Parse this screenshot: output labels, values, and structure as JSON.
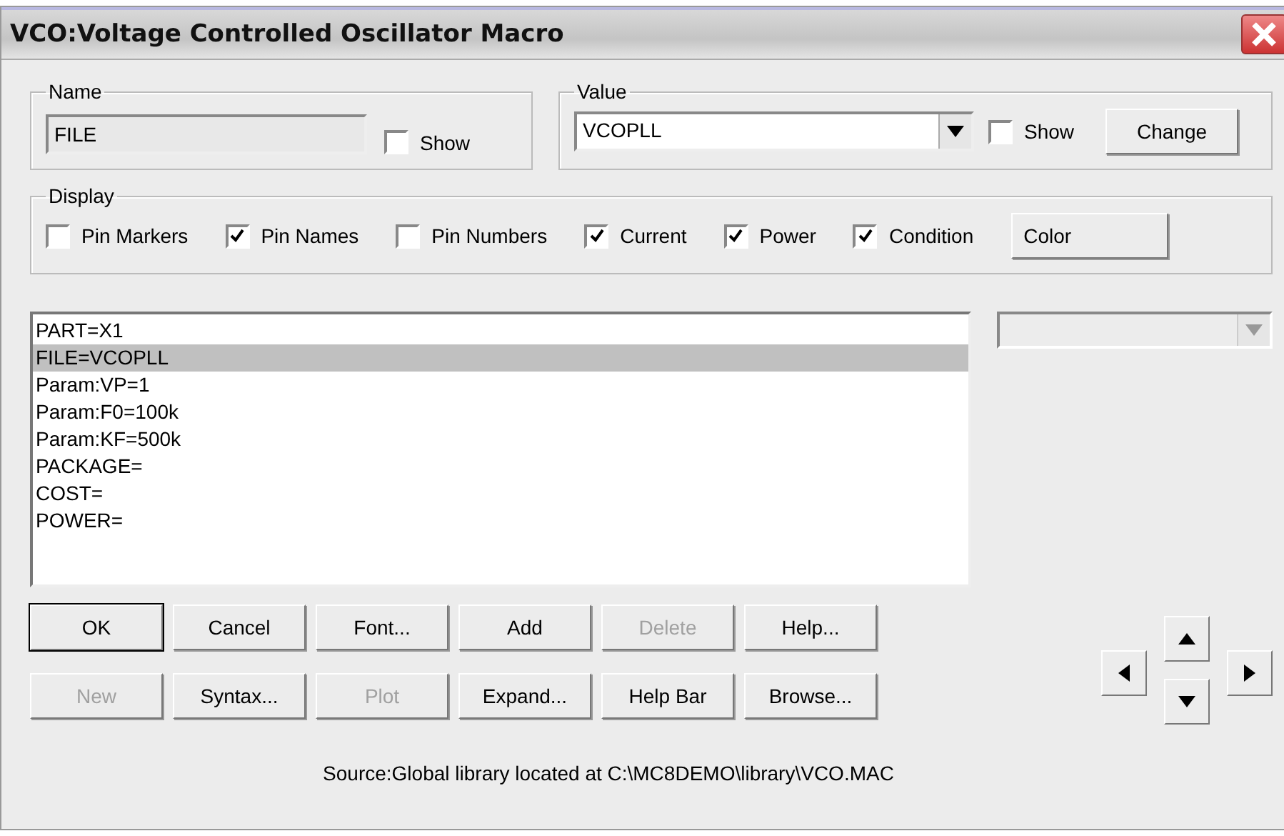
{
  "window": {
    "title": "VCO:Voltage Controlled Oscillator Macro"
  },
  "name_group": {
    "label": "Name",
    "value": "FILE",
    "show": {
      "label": "Show",
      "checked": false
    }
  },
  "value_group": {
    "label": "Value",
    "value": "VCOPLL",
    "show": {
      "label": "Show",
      "checked": false
    },
    "change_button": "Change"
  },
  "display_group": {
    "label": "Display",
    "options": [
      {
        "label": "Pin Markers",
        "checked": false
      },
      {
        "label": "Pin Names",
        "checked": true
      },
      {
        "label": "Pin Numbers",
        "checked": false
      },
      {
        "label": "Current",
        "checked": true
      },
      {
        "label": "Power",
        "checked": true
      },
      {
        "label": "Condition",
        "checked": true
      }
    ],
    "color_button": "Color"
  },
  "attributes": [
    {
      "text": "PART=X1",
      "selected": false
    },
    {
      "text": "FILE=VCOPLL",
      "selected": true
    },
    {
      "text": "Param:VP=1",
      "selected": false
    },
    {
      "text": "Param:F0=100k",
      "selected": false
    },
    {
      "text": "Param:KF=500k",
      "selected": false
    },
    {
      "text": "PACKAGE=",
      "selected": false
    },
    {
      "text": "COST=",
      "selected": false
    },
    {
      "text": "POWER=",
      "selected": false
    }
  ],
  "side_dropdown": {
    "disabled": true
  },
  "buttons": [
    [
      {
        "label": "OK",
        "disabled": false,
        "default": true
      },
      {
        "label": "Cancel",
        "disabled": false,
        "default": false
      },
      {
        "label": "Font...",
        "disabled": false,
        "default": false
      },
      {
        "label": "Add",
        "disabled": false,
        "default": false
      },
      {
        "label": "Delete",
        "disabled": true,
        "default": false
      },
      {
        "label": "Help...",
        "disabled": false,
        "default": false
      }
    ],
    [
      {
        "label": "New",
        "disabled": true,
        "default": false
      },
      {
        "label": "Syntax...",
        "disabled": false,
        "default": false
      },
      {
        "label": "Plot",
        "disabled": true,
        "default": false
      },
      {
        "label": "Expand...",
        "disabled": false,
        "default": false
      },
      {
        "label": "Help Bar",
        "disabled": false,
        "default": false
      },
      {
        "label": "Browse...",
        "disabled": false,
        "default": false
      }
    ]
  ],
  "source": "Source:Global library located at C:\\MC8DEMO\\library\\VCO.MAC"
}
